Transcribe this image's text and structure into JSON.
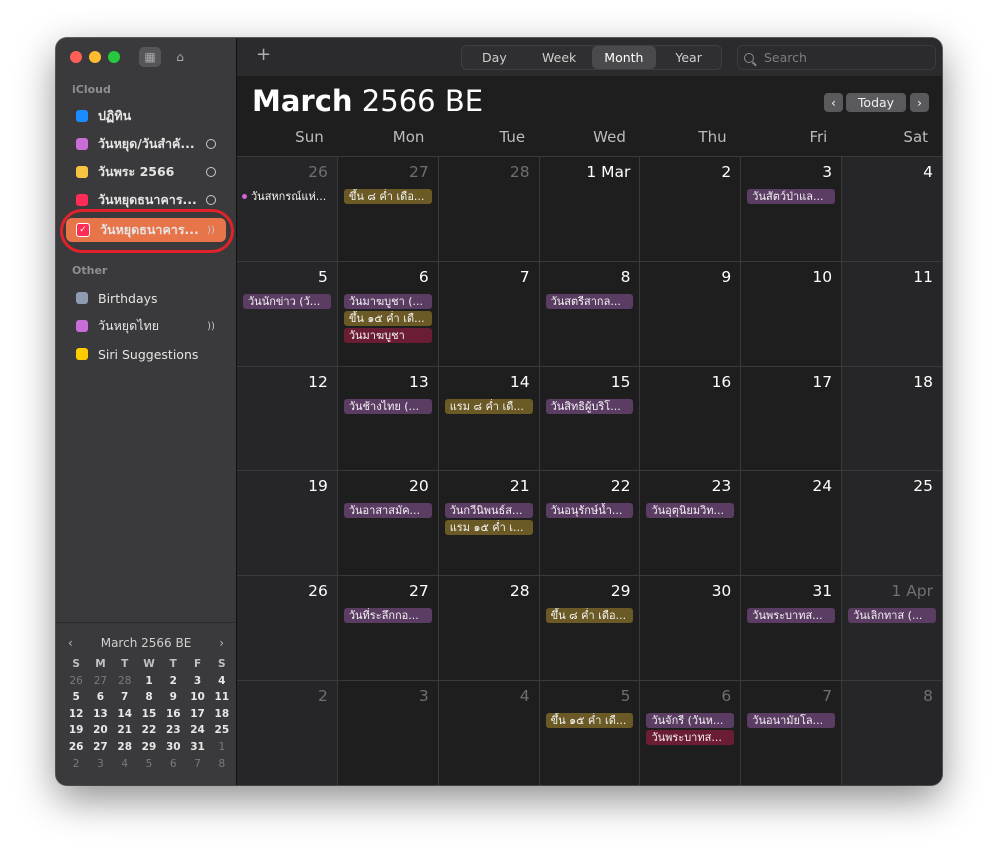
{
  "sidebar": {
    "icloud_label": "iCloud",
    "other_label": "Other",
    "calendars": [
      {
        "label": "ปฏิทิน",
        "color": "#1a8cff",
        "checked": false,
        "trail": ""
      },
      {
        "label": "วันหยุด/วันสำคั...",
        "color": "#c86dd7",
        "checked": true,
        "trail": "person"
      },
      {
        "label": "วันพระ 2566",
        "color": "#f5c542",
        "checked": true,
        "trail": "person"
      },
      {
        "label": "วันหยุดธนาคาร...",
        "color": "#ff2d55",
        "checked": false,
        "trail": "person"
      },
      {
        "label": "วันหยุดธนาคาร...",
        "color": "#ff2d55",
        "checked": true,
        "trail": "broadcast",
        "selected": true
      }
    ],
    "other": [
      {
        "label": "Birthdays",
        "color": "#8e9bb0"
      },
      {
        "label": "วันหยุดไทย",
        "color": "#c86dd7",
        "trail": "broadcast"
      },
      {
        "label": "Siri Suggestions",
        "color": "#ffcc00"
      }
    ],
    "mini_month": {
      "title": "March 2566 BE",
      "dow": [
        "S",
        "M",
        "T",
        "W",
        "T",
        "F",
        "S"
      ],
      "weeks": [
        [
          "26",
          "27",
          "28",
          "1",
          "2",
          "3",
          "4"
        ],
        [
          "5",
          "6",
          "7",
          "8",
          "9",
          "10",
          "11"
        ],
        [
          "12",
          "13",
          "14",
          "15",
          "16",
          "17",
          "18"
        ],
        [
          "19",
          "20",
          "21",
          "22",
          "23",
          "24",
          "25"
        ],
        [
          "26",
          "27",
          "28",
          "29",
          "30",
          "31",
          "1"
        ],
        [
          "2",
          "3",
          "4",
          "5",
          "6",
          "7",
          "8"
        ]
      ]
    }
  },
  "toolbar": {
    "add": "+",
    "views": [
      "Day",
      "Week",
      "Month",
      "Year"
    ],
    "active_view": "Month",
    "search_placeholder": "Search"
  },
  "header": {
    "month": "March",
    "year": "2566 BE",
    "today_label": "Today"
  },
  "weekdays": [
    "Sun",
    "Mon",
    "Tue",
    "Wed",
    "Thu",
    "Fri",
    "Sat"
  ],
  "weeks": [
    [
      {
        "d": "26",
        "dim": true,
        "events": [
          {
            "t": "วันสหกรณ์แห่...",
            "c": "plain"
          }
        ]
      },
      {
        "d": "27",
        "dim": true,
        "events": [
          {
            "t": "ขึ้น ๘ ค่ำ เดือ...",
            "c": "gold"
          }
        ]
      },
      {
        "d": "28",
        "dim": true,
        "events": []
      },
      {
        "d": "1 Mar",
        "events": []
      },
      {
        "d": "2",
        "events": []
      },
      {
        "d": "3",
        "events": [
          {
            "t": "วันสัตว์ป่าแล...",
            "c": "purple"
          }
        ]
      },
      {
        "d": "4",
        "events": []
      }
    ],
    [
      {
        "d": "5",
        "events": [
          {
            "t": "วันนักข่าว (วั...",
            "c": "purple"
          }
        ]
      },
      {
        "d": "6",
        "events": [
          {
            "t": "วันมาฆบูชา (...",
            "c": "purple"
          },
          {
            "t": "ขึ้น ๑๕ ค่ำ เดื...",
            "c": "gold"
          },
          {
            "t": "วันมาฆบูชา",
            "c": "red"
          }
        ]
      },
      {
        "d": "7",
        "events": []
      },
      {
        "d": "8",
        "events": [
          {
            "t": "วันสตรีสากล...",
            "c": "purple"
          }
        ]
      },
      {
        "d": "9",
        "events": []
      },
      {
        "d": "10",
        "events": []
      },
      {
        "d": "11",
        "events": []
      }
    ],
    [
      {
        "d": "12",
        "events": []
      },
      {
        "d": "13",
        "events": [
          {
            "t": "วันช้างไทย (...",
            "c": "purple"
          }
        ]
      },
      {
        "d": "14",
        "events": [
          {
            "t": "แรม ๘ ค่ำ เดื...",
            "c": "gold"
          }
        ]
      },
      {
        "d": "15",
        "events": [
          {
            "t": "วันสิทธิผู้บริโ...",
            "c": "purple"
          }
        ]
      },
      {
        "d": "16",
        "events": []
      },
      {
        "d": "17",
        "events": []
      },
      {
        "d": "18",
        "events": []
      }
    ],
    [
      {
        "d": "19",
        "events": []
      },
      {
        "d": "20",
        "events": [
          {
            "t": "วันอาสาสมัค...",
            "c": "purple"
          }
        ]
      },
      {
        "d": "21",
        "events": [
          {
            "t": "วันกวีนิพนธ์ส...",
            "c": "purple"
          },
          {
            "t": "แรม ๑๕ ค่ำ เ...",
            "c": "gold"
          }
        ]
      },
      {
        "d": "22",
        "events": [
          {
            "t": "วันอนุรักษ์น้ำ...",
            "c": "purple"
          }
        ]
      },
      {
        "d": "23",
        "events": [
          {
            "t": "วันอุตุนิยมวิท...",
            "c": "purple"
          }
        ]
      },
      {
        "d": "24",
        "events": []
      },
      {
        "d": "25",
        "events": []
      }
    ],
    [
      {
        "d": "26",
        "events": []
      },
      {
        "d": "27",
        "events": [
          {
            "t": "วันที่ระลึกกอ...",
            "c": "purple"
          }
        ]
      },
      {
        "d": "28",
        "events": []
      },
      {
        "d": "29",
        "events": [
          {
            "t": "ขึ้น ๘ ค่ำ เดือ...",
            "c": "gold"
          }
        ]
      },
      {
        "d": "30",
        "events": []
      },
      {
        "d": "31",
        "events": [
          {
            "t": "วันพระบาทส...",
            "c": "purple"
          }
        ]
      },
      {
        "d": "1 Apr",
        "dim": true,
        "events": [
          {
            "t": "วันเลิกทาส (...",
            "c": "purple"
          }
        ]
      }
    ],
    [
      {
        "d": "2",
        "dim": true,
        "events": []
      },
      {
        "d": "3",
        "dim": true,
        "events": []
      },
      {
        "d": "4",
        "dim": true,
        "events": []
      },
      {
        "d": "5",
        "dim": true,
        "events": [
          {
            "t": "ขึ้น ๑๕ ค่ำ เดื...",
            "c": "gold"
          }
        ]
      },
      {
        "d": "6",
        "dim": true,
        "events": [
          {
            "t": "วันจักรี (วันห...",
            "c": "purple"
          },
          {
            "t": "วันพระบาทส...",
            "c": "red"
          }
        ]
      },
      {
        "d": "7",
        "dim": true,
        "events": [
          {
            "t": "วันอนามัยโล...",
            "c": "purple"
          }
        ]
      },
      {
        "d": "8",
        "dim": true,
        "events": []
      }
    ]
  ]
}
